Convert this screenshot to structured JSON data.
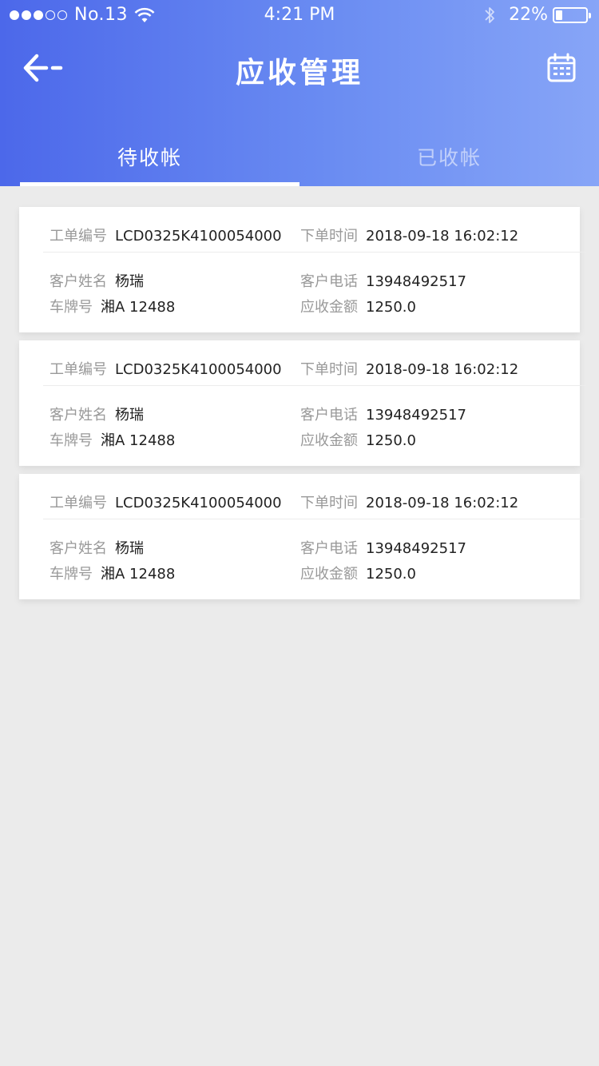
{
  "status_bar": {
    "carrier": "No.13",
    "time": "4:21 PM",
    "battery_percent": "22%",
    "battery_level": 0.22,
    "signal_bars": 3,
    "signal_total": 5
  },
  "nav": {
    "title": "应收管理",
    "back_icon": "back-arrow-icon",
    "calendar_icon": "calendar-icon"
  },
  "tabs": [
    {
      "label": "待收帐",
      "active": true
    },
    {
      "label": "已收帐",
      "active": false
    }
  ],
  "colors": {
    "header_gradient_start": "#4c68ea",
    "header_gradient_end": "#87a5f7",
    "background": "#ebebeb",
    "label_gray": "#999999",
    "value_dark": "#222222"
  },
  "labels": {
    "order_no": "工单编号",
    "order_time": "下单时间",
    "customer_name": "客户姓名",
    "customer_phone": "客户电话",
    "plate": "车牌号",
    "amount": "应收金额"
  },
  "cards": [
    {
      "order_no": "LCD0325K4100054000",
      "order_time": "2018-09-18 16:02:12",
      "customer_name": "杨瑞",
      "customer_phone": "13948492517",
      "plate": "湘A 12488",
      "amount": "1250.0"
    },
    {
      "order_no": "LCD0325K4100054000",
      "order_time": "2018-09-18 16:02:12",
      "customer_name": "杨瑞",
      "customer_phone": "13948492517",
      "plate": "湘A 12488",
      "amount": "1250.0"
    },
    {
      "order_no": "LCD0325K4100054000",
      "order_time": "2018-09-18 16:02:12",
      "customer_name": "杨瑞",
      "customer_phone": "13948492517",
      "plate": "湘A 12488",
      "amount": "1250.0"
    }
  ]
}
